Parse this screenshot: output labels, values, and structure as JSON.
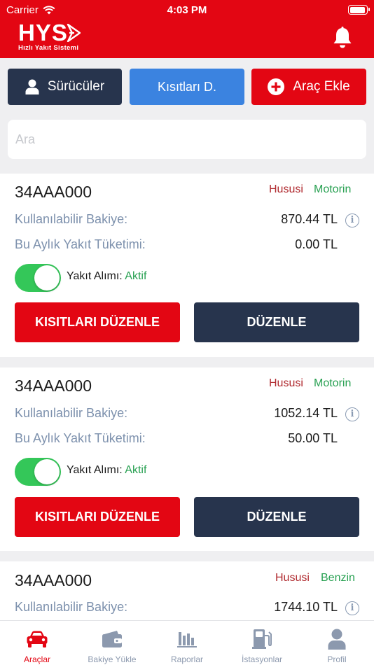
{
  "status_bar": {
    "carrier": "Carrier",
    "time": "4:03 PM"
  },
  "header": {
    "logo_text": "HYS",
    "logo_subtitle": "Hızlı Yakıt Sistemi",
    "notification_icon": "bell-icon"
  },
  "actions": {
    "drivers": {
      "label": "Sürücüler",
      "icon": "user-icon"
    },
    "restrictions": {
      "label": "Kısıtları D."
    },
    "add_vehicle": {
      "label": "Araç Ekle",
      "icon": "plus-circle-icon"
    }
  },
  "search": {
    "placeholder": "Ara",
    "value": ""
  },
  "labels": {
    "available_balance": "Kullanılabilir Bakiye:",
    "monthly_consumption": "Bu Aylık Yakıt Tüketimi:",
    "fuel_purchase": "Yakıt Alımı:",
    "edit_restrictions": "KISITLARI DÜZENLE",
    "edit": "DÜZENLE"
  },
  "vehicles": [
    {
      "plate": "34AAA000",
      "type": "Hususi",
      "fuel": "Motorin",
      "balance": "870.44 TL",
      "consumption": "0.00 TL",
      "fuel_purchase_enabled": true,
      "fuel_purchase_status": "Aktif"
    },
    {
      "plate": "34AAA000",
      "type": "Hususi",
      "fuel": "Motorin",
      "balance": "1052.14 TL",
      "consumption": "50.00 TL",
      "fuel_purchase_enabled": true,
      "fuel_purchase_status": "Aktif"
    },
    {
      "plate": "34AAA000",
      "type": "Hususi",
      "fuel": "Benzin",
      "balance": "1744.10 TL"
    }
  ],
  "tabs": [
    {
      "label": "Araçlar",
      "icon": "car-icon",
      "active": true
    },
    {
      "label": "Bakiye Yükle",
      "icon": "wallet-icon",
      "active": false
    },
    {
      "label": "Raporlar",
      "icon": "bar-chart-icon",
      "active": false
    },
    {
      "label": "İstasyonlar",
      "icon": "fuel-pump-icon",
      "active": false
    },
    {
      "label": "Profil",
      "icon": "profile-icon",
      "active": false
    }
  ],
  "colors": {
    "brand_red": "#e30613",
    "navy": "#27344d",
    "blue": "#3b83e0",
    "green": "#27a051",
    "toggle_on": "#34c759"
  }
}
